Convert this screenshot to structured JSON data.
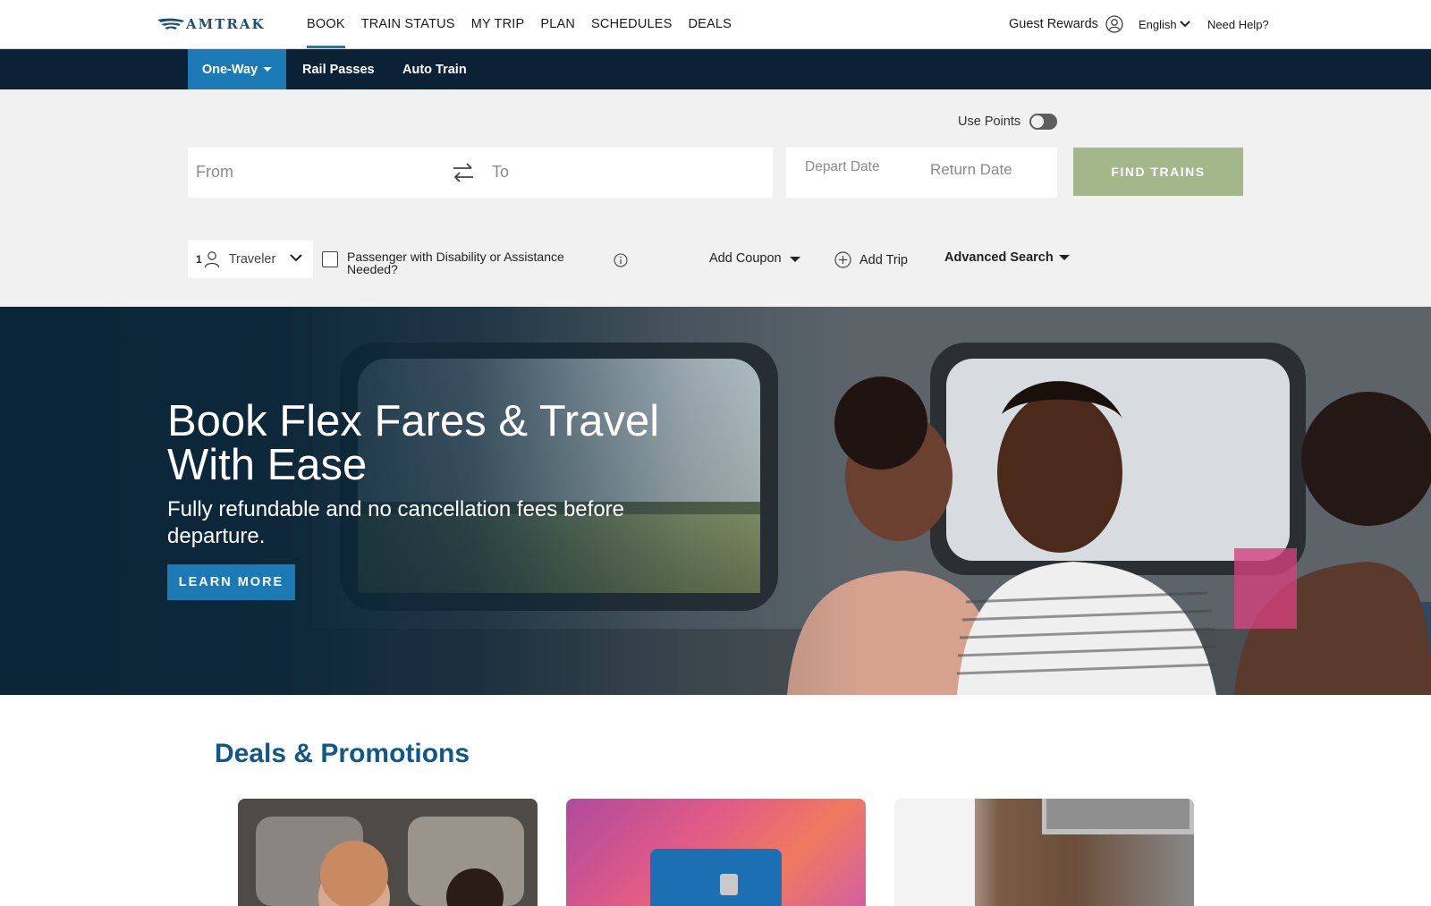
{
  "brand": {
    "logo_text": "AMTRAK"
  },
  "nav": {
    "items": [
      {
        "label": "BOOK",
        "active": true
      },
      {
        "label": "TRAIN STATUS",
        "active": false
      },
      {
        "label": "MY TRIP",
        "active": false
      },
      {
        "label": "PLAN",
        "active": false
      },
      {
        "label": "SCHEDULES",
        "active": false
      },
      {
        "label": "DEALS",
        "active": false
      }
    ],
    "guest_rewards": "Guest Rewards",
    "language": "English",
    "help": "Need Help?"
  },
  "subnav": {
    "one_way": "One-Way",
    "rail_passes": "Rail Passes",
    "auto_train": "Auto Train"
  },
  "search": {
    "use_points": "Use Points",
    "from_placeholder": "From",
    "to_placeholder": "To",
    "depart_placeholder": "Depart Date",
    "return_placeholder": "Return Date",
    "find_trains": "FIND TRAINS",
    "traveler_count": "1",
    "traveler_label": "Traveler",
    "disability_label": "Passenger with Disability or Assistance Needed?",
    "add_coupon": "Add Coupon",
    "add_trip": "Add Trip",
    "advanced_search": "Advanced Search"
  },
  "hero": {
    "title": "Book Flex Fares & Travel With Ease",
    "subtitle": "Fully refundable and no cancellation fees before departure.",
    "cta": "LEARN MORE"
  },
  "deals": {
    "title": "Deals & Promotions"
  },
  "colors": {
    "primary_blue": "#1b7ab6",
    "navy": "#0b2236",
    "find_trains_green": "#a4b78a",
    "deals_title": "#12578a"
  }
}
